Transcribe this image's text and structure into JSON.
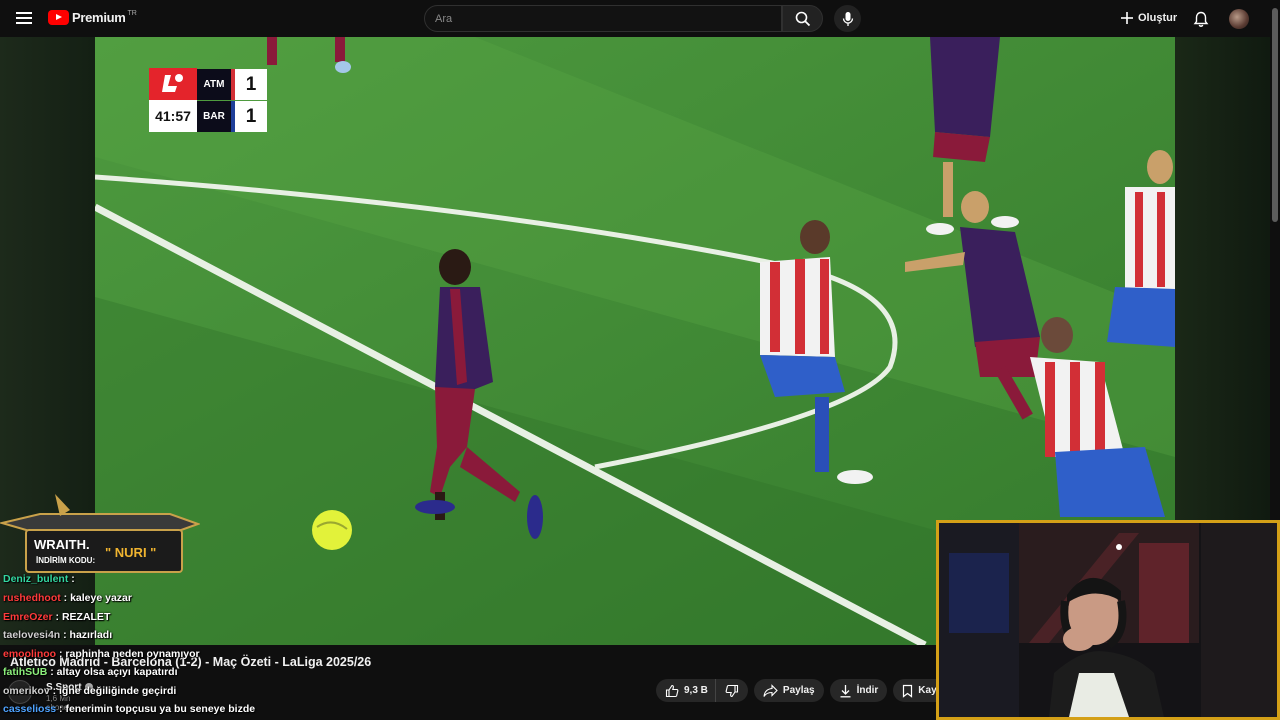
{
  "topbar": {
    "brand": "Premium",
    "region": "TR",
    "search_placeholder": "Ara",
    "create_label": "Oluştur"
  },
  "scoreboard": {
    "clock": "41:57",
    "home_team": "ATM",
    "home_score": "1",
    "away_team": "BAR",
    "away_score": "1"
  },
  "video": {
    "title": "Atletico Madrid - Barcelona (1-2) - Maç Özeti - LaLiga 2025/26",
    "channel_name": "S Sport",
    "channel_subs": "1,6 Mn abone",
    "likes": "9,3 B",
    "share_label": "Paylaş",
    "download_label": "İndir",
    "save_label": "Kayde"
  },
  "promo": {
    "brand": "WRAITH.",
    "code_label": "İNDİRİM KODU:",
    "code": "\" NURI \""
  },
  "chat": [
    {
      "user": "Deniz_bulent",
      "message": " : ",
      "color": "#33d6a0"
    },
    {
      "user": "rushedhoot",
      "message": " : kaleye yazar",
      "color": "#ff3b3b"
    },
    {
      "user": "EmreOzer",
      "message": " : REZALET",
      "color": "#ff3b3b"
    },
    {
      "user": "taelovesi4n",
      "message": " : hazırladı",
      "color": "#cfcfcf"
    },
    {
      "user": "emoolinoo",
      "message": " : raphinha neden oynamıyor",
      "color": "#ff3b3b"
    },
    {
      "user": "fatihSUB",
      "message": " : altay olsa açıyı kapatırdı",
      "color": "#8cf07c"
    },
    {
      "user": "omerikov",
      "message": " : iğne değiliğinde geçirdi",
      "color": "#cfcfcf"
    },
    {
      "user": "casselioss",
      "message": " : fenerimin topçusu ya bu seneye bizde",
      "color": "#4fa3ff"
    }
  ],
  "colors": {
    "accent": "#ff0000",
    "laliga_red": "#e4242b",
    "webcam_border": "#d4a017"
  },
  "icons": [
    "menu-icon",
    "youtube-logo-icon",
    "search-icon",
    "mic-icon",
    "plus-icon",
    "bell-icon",
    "like-icon",
    "dislike-icon",
    "share-icon",
    "download-icon",
    "save-icon",
    "laliga-icon"
  ]
}
